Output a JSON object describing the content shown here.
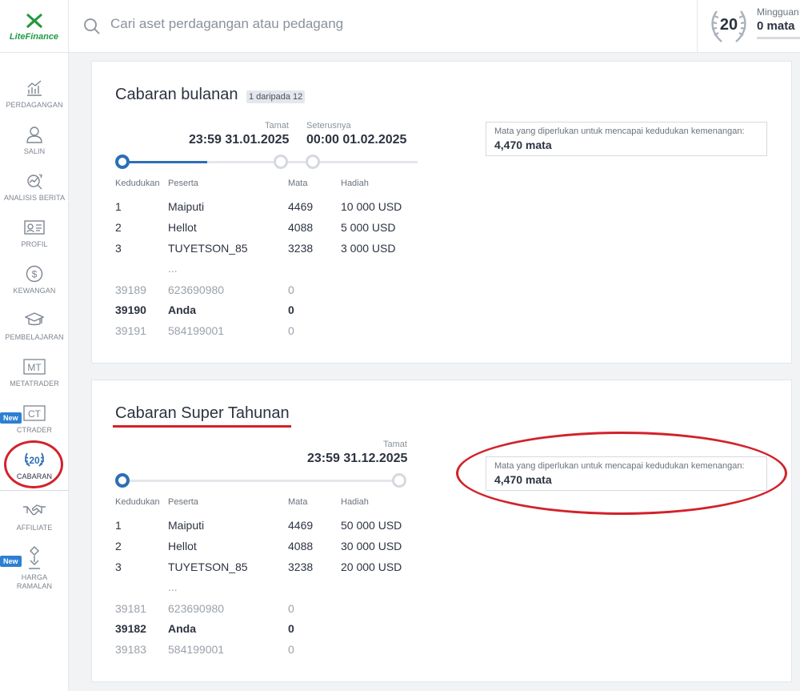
{
  "brand": {
    "name_lite": "Lite",
    "name_finance": "Finance"
  },
  "search": {
    "placeholder": "Cari aset perdagangan atau pedagang"
  },
  "rank": {
    "number": "20",
    "period": "Mingguan",
    "points": "0 mata"
  },
  "sidebar": {
    "items": [
      {
        "label": "PERDAGANGAN",
        "icon": "chart-icon"
      },
      {
        "label": "SALIN",
        "icon": "user-icon"
      },
      {
        "label": "ANALISIS BERITA",
        "icon": "analysis-icon"
      },
      {
        "label": "PROFIL",
        "icon": "id-card-icon"
      },
      {
        "label": "KEWANGAN",
        "icon": "dollar-icon"
      },
      {
        "label": "PEMBELAJARAN",
        "icon": "graduation-cap-icon"
      },
      {
        "label": "METATRADER",
        "icon": "mt-icon",
        "icon_text": "MT"
      },
      {
        "label": "CTRADER",
        "icon": "ct-icon",
        "icon_text": "CT",
        "badge": "New"
      },
      {
        "label": "CABARAN",
        "icon": "laurel-icon",
        "icon_text": "20"
      },
      {
        "label": "AFFILIATE",
        "icon": "handshake-icon"
      },
      {
        "label": "HARGA",
        "label2": "RAMALAN",
        "icon": "forecast-icon",
        "badge": "New"
      }
    ]
  },
  "monthly": {
    "title": "Cabaran bulanan",
    "counter": "1 daripada 12",
    "end_label": "Tamat",
    "end_date": "23:59 31.01.2025",
    "next_label": "Seterusnya",
    "next_date": "00:00 01.02.2025",
    "headers": [
      "Kedudukan",
      "Peserta",
      "Mata",
      "Hadiah"
    ],
    "rows": [
      {
        "rank": "1",
        "name": "Maiputi",
        "points": "4469",
        "prize": "10 000 USD"
      },
      {
        "rank": "2",
        "name": "Hellot",
        "points": "4088",
        "prize": "5 000 USD"
      },
      {
        "rank": "3",
        "name": "TUYETSON_85",
        "points": "3238",
        "prize": "3 000 USD"
      }
    ],
    "ellipsis": "...",
    "near": [
      {
        "rank": "39189",
        "name": "623690980",
        "points": "0"
      },
      {
        "rank": "39190",
        "name": "Anda",
        "points": "0"
      },
      {
        "rank": "39191",
        "name": "584199001",
        "points": "0"
      }
    ],
    "info_label": "Mata yang diperlukan untuk mencapai kedudukan kemenangan:",
    "info_value": "4,470 mata"
  },
  "yearly": {
    "title": "Cabaran Super Tahunan",
    "end_label": "Tamat",
    "end_date": "23:59 31.12.2025",
    "headers": [
      "Kedudukan",
      "Peserta",
      "Mata",
      "Hadiah"
    ],
    "rows": [
      {
        "rank": "1",
        "name": "Maiputi",
        "points": "4469",
        "prize": "50 000 USD"
      },
      {
        "rank": "2",
        "name": "Hellot",
        "points": "4088",
        "prize": "30 000 USD"
      },
      {
        "rank": "3",
        "name": "TUYETSON_85",
        "points": "3238",
        "prize": "20 000 USD"
      }
    ],
    "ellipsis": "...",
    "near": [
      {
        "rank": "39181",
        "name": "623690980",
        "points": "0"
      },
      {
        "rank": "39182",
        "name": "Anda",
        "points": "0"
      },
      {
        "rank": "39183",
        "name": "584199001",
        "points": "0"
      }
    ],
    "info_label": "Mata yang diperlukan untuk mencapai kedudukan kemenangan:",
    "info_value": "4,470 mata"
  },
  "colors": {
    "accent": "#2d6fb5",
    "annotation": "#d2222a",
    "brand_green": "#1d9b45"
  }
}
